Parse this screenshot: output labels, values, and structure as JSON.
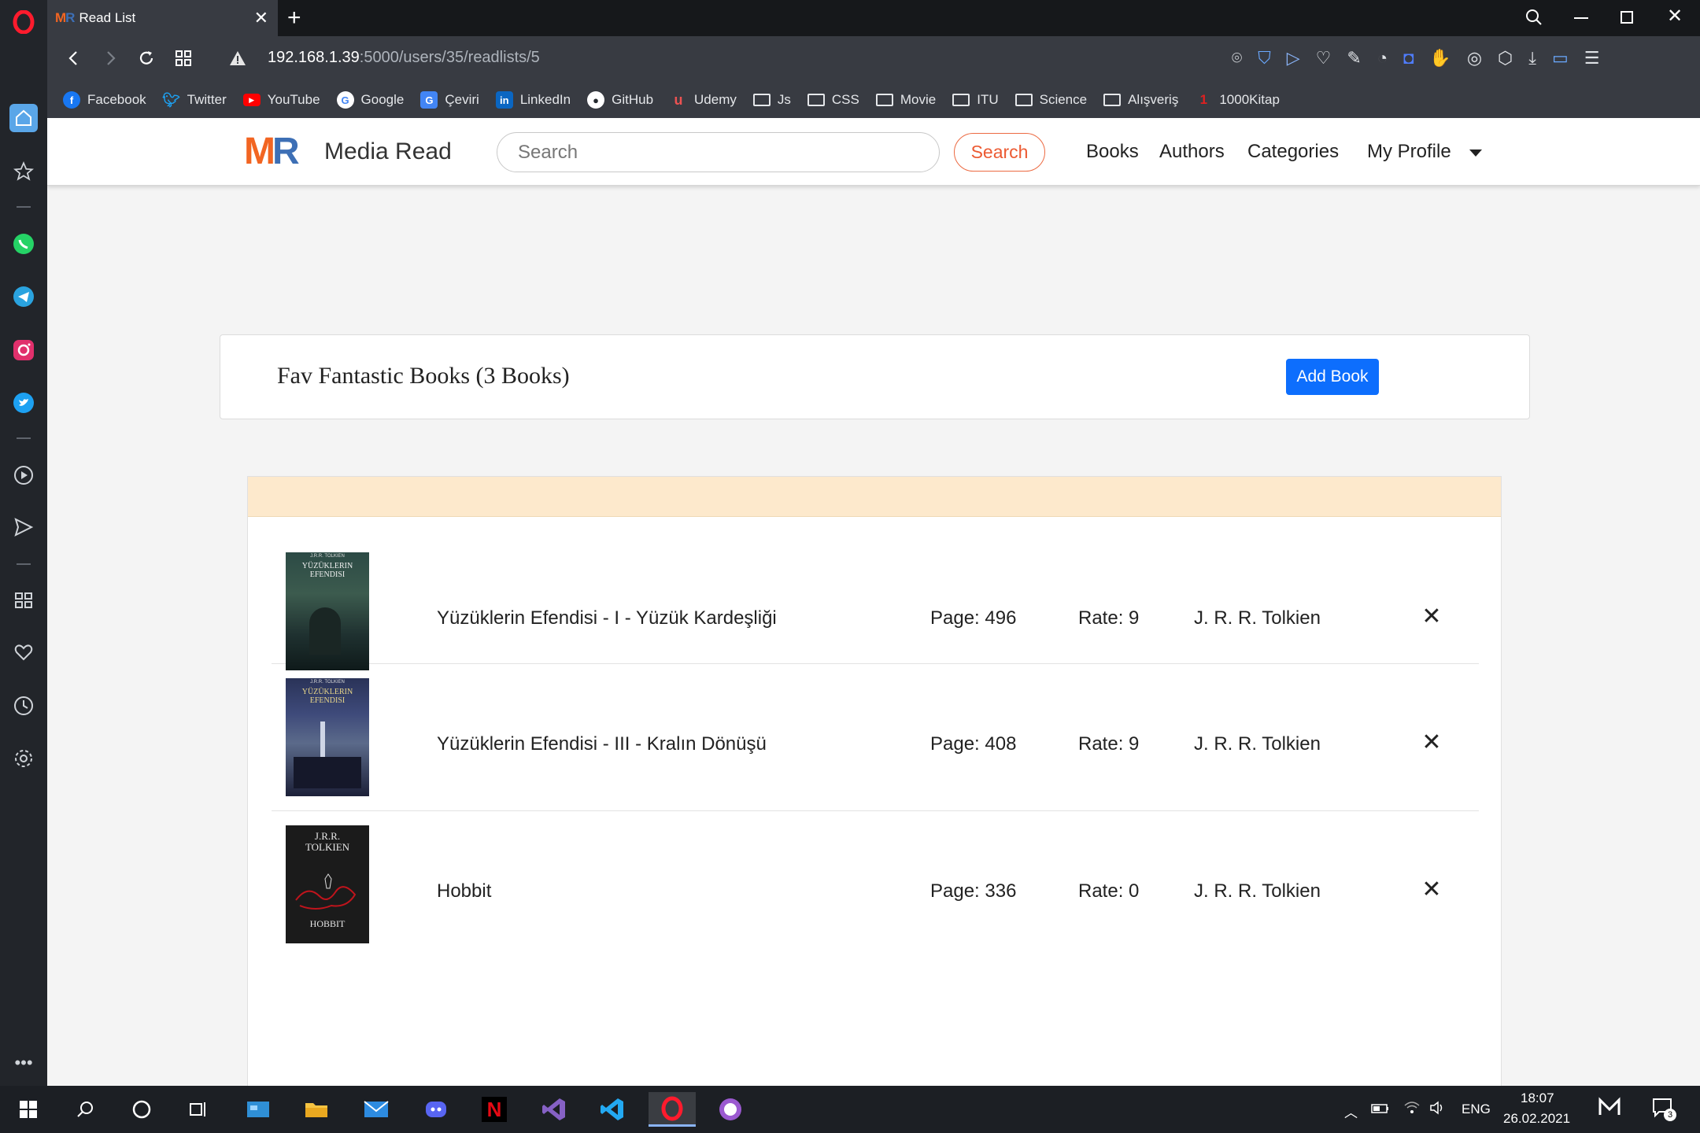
{
  "browser": {
    "tab_title": "Read List",
    "tab_logo_m": "M",
    "tab_logo_r": "R",
    "url_host": "192.168.1.39",
    "url_path": ":5000/users/35/readlists/5",
    "bookmarks": [
      {
        "label": "Facebook",
        "icon": "facebook-icon"
      },
      {
        "label": "Twitter",
        "icon": "twitter-icon"
      },
      {
        "label": "YouTube",
        "icon": "youtube-icon"
      },
      {
        "label": "Google",
        "icon": "google-icon"
      },
      {
        "label": "Çeviri",
        "icon": "translate-icon"
      },
      {
        "label": "LinkedIn",
        "icon": "linkedin-icon"
      },
      {
        "label": "GitHub",
        "icon": "github-icon"
      },
      {
        "label": "Udemy",
        "icon": "udemy-icon"
      },
      {
        "label": "Js",
        "icon": "folder-icon"
      },
      {
        "label": "CSS",
        "icon": "folder-icon"
      },
      {
        "label": "Movie",
        "icon": "folder-icon"
      },
      {
        "label": "ITU",
        "icon": "folder-icon"
      },
      {
        "label": "Science",
        "icon": "folder-icon"
      },
      {
        "label": "Alışveriş",
        "icon": "folder-icon"
      },
      {
        "label": "1000Kitap",
        "icon": "1000kitap-icon"
      }
    ]
  },
  "site": {
    "logo_m": "M",
    "logo_r": "R",
    "brand_name": "Media Read",
    "search_placeholder": "Search",
    "search_button": "Search",
    "nav": {
      "books": "Books",
      "authors": "Authors",
      "categories": "Categories",
      "profile": "My Profile"
    },
    "colors": {
      "logo_m": "#f26522",
      "logo_r": "#3d6fb5",
      "accent": "#ec5a32",
      "primary": "#0d6efd"
    }
  },
  "readlist": {
    "title": "Fav Fantastic Books (3 Books)",
    "add_button": "Add Book",
    "books": [
      {
        "title": "Yüzüklerin Efendisi - I - Yüzük Kardeşliği",
        "pages": "Page: 496",
        "rate": "Rate: 9",
        "author": "J. R. R. Tolkien",
        "cover_author": "J.R.R. TOLKIEN",
        "cover_title_1": "YÜZÜKLERIN",
        "cover_title_2": "EFENDISI"
      },
      {
        "title": "Yüzüklerin Efendisi - III - Kralın Dönüşü",
        "pages": "Page: 408",
        "rate": "Rate: 9",
        "author": "J. R. R. Tolkien",
        "cover_author": "J.R.R. TOLKIEN",
        "cover_title_1": "YÜZÜKLERIN",
        "cover_title_2": "EFENDISI"
      },
      {
        "title": "Hobbit",
        "pages": "Page: 336",
        "rate": "Rate: 0",
        "author": "J. R. R. Tolkien",
        "cover_author_1": "J.R.R.",
        "cover_author_2": "TOLKIEN",
        "cover_title": "HOBBIT"
      }
    ],
    "remove_glyph": "✕"
  },
  "taskbar": {
    "language": "ENG",
    "time": "18:07",
    "date": "26.02.2021",
    "notification_count": "3"
  }
}
